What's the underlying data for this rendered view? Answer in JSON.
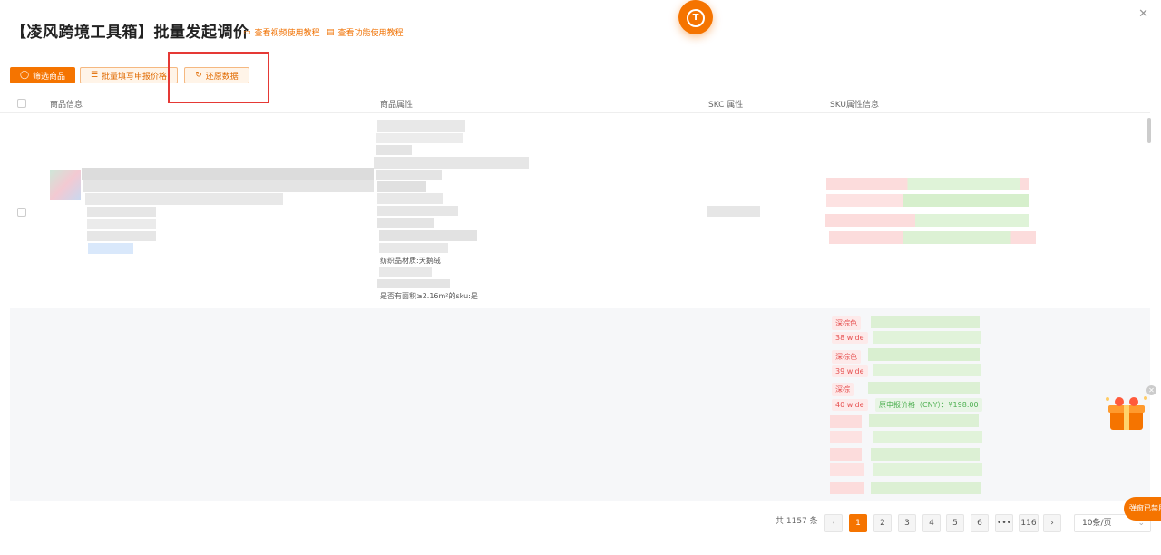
{
  "header": {
    "title": "【凌风跨境工具箱】批量发起调价",
    "video_link": "查看视频使用教程",
    "doc_link": "查看功能使用教程"
  },
  "toolbar": {
    "filter_label": "筛选商品",
    "batch_label": "批量填写申报价格",
    "restore_label": "还原数据"
  },
  "table": {
    "columns": [
      "商品信息",
      "商品属性",
      "SKC 属性",
      "SKU属性信息"
    ],
    "row1": {
      "attr_material": "纺织品材质:天鹅绒",
      "attr_area": "是否有面积≥2.16m²的sku:是"
    },
    "row2": {
      "colors": [
        "深棕色",
        "深棕色",
        "深棕"
      ],
      "sizes": [
        "38 wide",
        "39 wide",
        "40 wide"
      ],
      "price_label": "原申报价格（CNY）：¥198.00"
    }
  },
  "pagination": {
    "total": "共 1157 条",
    "pages": [
      "1",
      "2",
      "3",
      "4",
      "5",
      "6",
      "•••",
      "116"
    ],
    "prev": "‹",
    "next": "›",
    "page_size": "10条/页"
  },
  "floating": {
    "popup_label": "弹窗已禁用"
  },
  "colors": {
    "accent": "#f57400",
    "highlight_box": "#e53935"
  }
}
